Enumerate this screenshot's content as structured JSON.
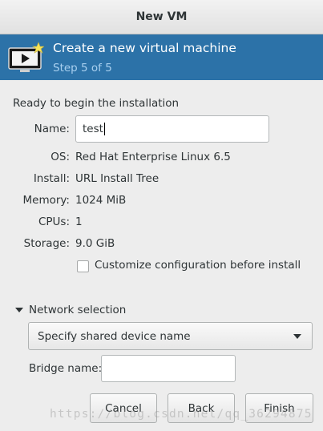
{
  "window": {
    "title": "New VM"
  },
  "banner": {
    "title": "Create a new virtual machine",
    "step": "Step 5 of 5",
    "icon": "vm-install-icon",
    "bg_color": "#2c72a8"
  },
  "summary": {
    "heading": "Ready to begin the installation",
    "name_label": "Name:",
    "name_value": "test",
    "rows": [
      {
        "label": "OS:",
        "value": "Red Hat Enterprise Linux 6.5"
      },
      {
        "label": "Install:",
        "value": "URL Install Tree"
      },
      {
        "label": "Memory:",
        "value": "1024 MiB"
      },
      {
        "label": "CPUs:",
        "value": "1"
      },
      {
        "label": "Storage:",
        "value": "9.0 GiB"
      }
    ],
    "customize_label": "Customize configuration before install",
    "customize_checked": false
  },
  "network": {
    "expander_label": "Network selection",
    "expanded": true,
    "selected_option": "Specify shared device name",
    "bridge_label": "Bridge name:",
    "bridge_value": ""
  },
  "buttons": {
    "cancel": "Cancel",
    "back": "Back",
    "finish": "Finish"
  },
  "watermark": "https://blog.csdn.net/qq_36294875"
}
